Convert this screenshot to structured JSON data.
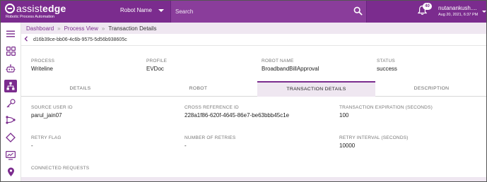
{
  "brand": {
    "name_light": "assist",
    "name_bold": "edge",
    "tagline": "Robotic Process Automation"
  },
  "header": {
    "robot_select": "Robot Name",
    "search_placeholder": "Search",
    "notification_count": "40",
    "user_name": "nutanankush....",
    "user_date": "Aug 20, 2021, 6:37 PM"
  },
  "sidebar": {
    "items": [
      "menu-icon",
      "apps-icon",
      "robot-icon",
      "process-view-icon",
      "key-icon",
      "workflow-icon",
      "diamond-icon",
      "monitor-icon",
      "location-icon"
    ],
    "active_index": 3
  },
  "breadcrumb": {
    "items": [
      "Dashboard",
      "Process View"
    ],
    "current": "Transaction Details"
  },
  "transaction_id": "d16b39ce-bb06-4c6b-9575-5d56b938605c",
  "summary": {
    "process_label": "PROCESS",
    "process_value": "Writeline",
    "profile_label": "PROFILE",
    "profile_value": "EVDoc",
    "robot_label": "ROBOT NAME",
    "robot_value": "BroadbandBillApproval",
    "status_label": "STATUS",
    "status_value": "success"
  },
  "tabs": [
    "DETAILS",
    "ROBOT",
    "TRANSACTION DETAILS",
    "DESCRIPTION"
  ],
  "active_tab": "TRANSACTION DETAILS",
  "details": {
    "source_user_id_label": "SOURCE USER ID",
    "source_user_id": "parul_jain07",
    "cross_ref_label": "CROSS REFERENCE ID",
    "cross_ref": "228a1f86-620f-4645-86e7-be63bbb45c1e",
    "expiration_label": "TRANSACTION EXPIRATION (SECONDS)",
    "expiration": "100",
    "retry_flag_label": "RETRY FLAG",
    "retry_flag": "-",
    "num_retries_label": "NUMBER OF RETRIES",
    "num_retries": "-",
    "retry_interval_label": "RETRY INTERVAL (SECONDS)",
    "retry_interval": "10000",
    "connected_requests_label": "CONNECTED REQUESTS"
  },
  "colors": {
    "brand_purple": "#7b2c8e",
    "tab_active_bg": "#efe7f1"
  }
}
